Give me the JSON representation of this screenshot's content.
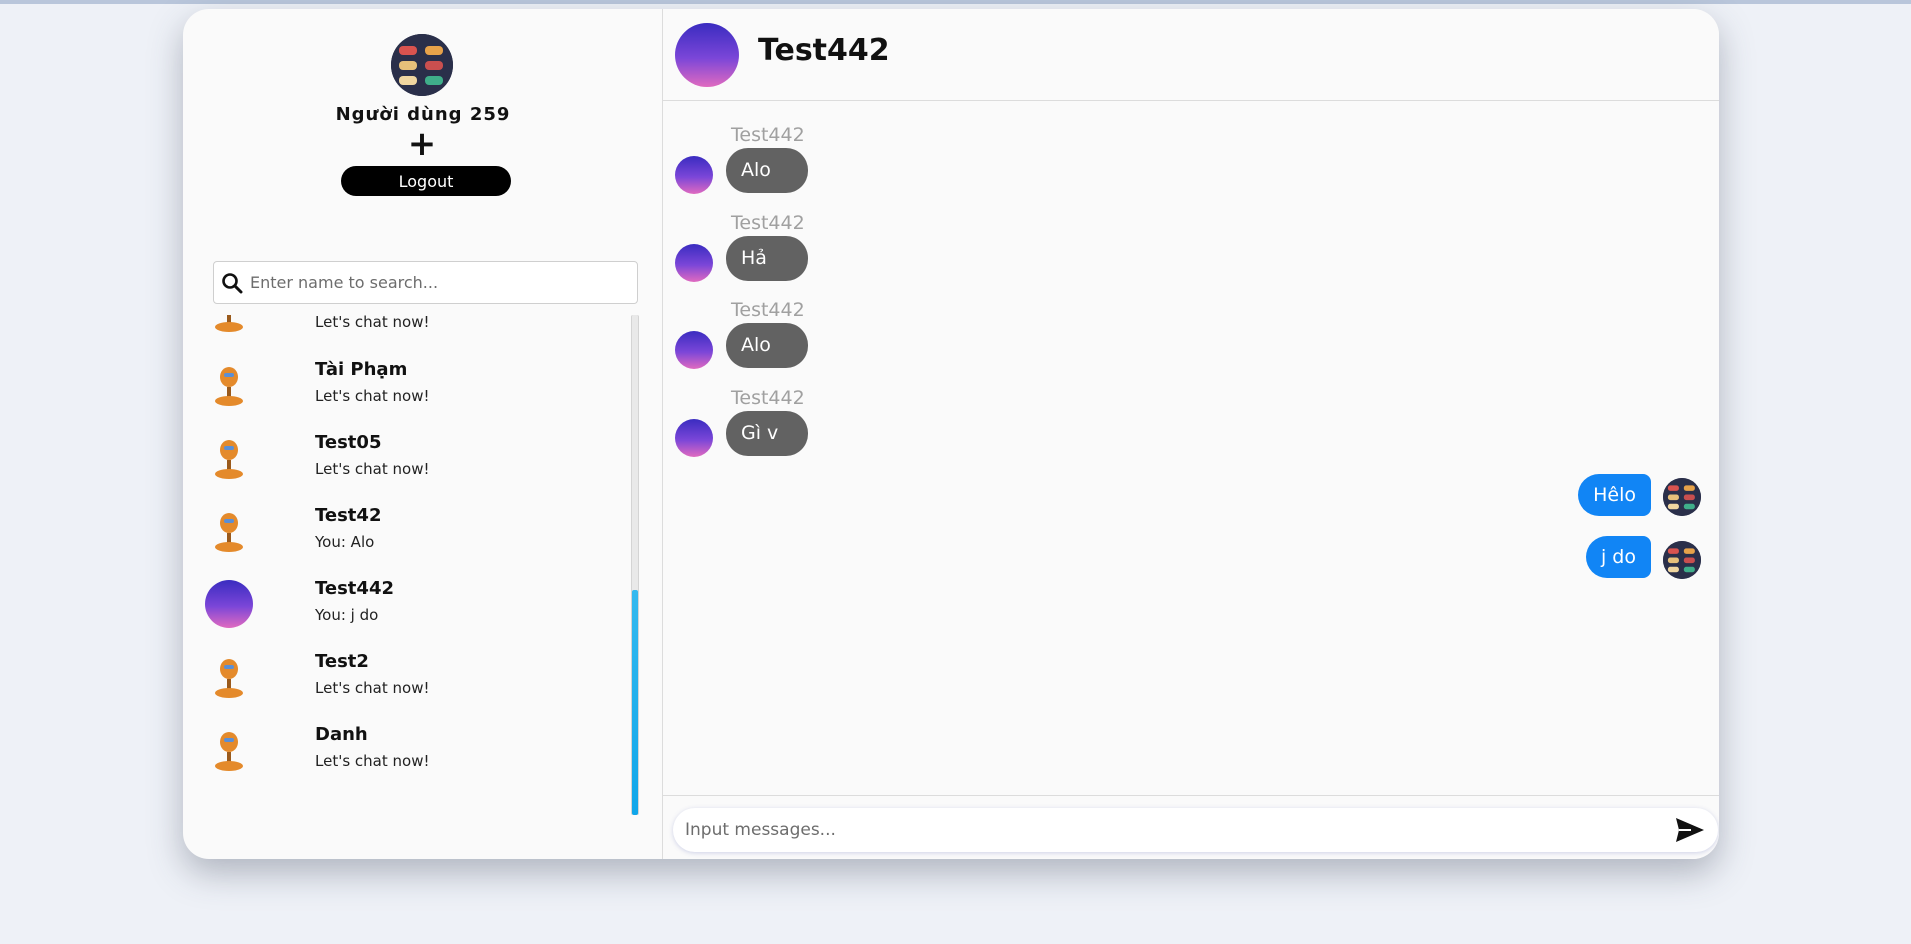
{
  "profile": {
    "username": "Người dùng 259",
    "add_label": "+",
    "logout_label": "Logout"
  },
  "search": {
    "placeholder": "Enter name to search..."
  },
  "contacts": [
    {
      "name": "",
      "last_message": "Let's chat now!",
      "avatar": "pumpkin-figure"
    },
    {
      "name": "Tài Phạm",
      "last_message": "Let's chat now!",
      "avatar": "pumpkin-figure"
    },
    {
      "name": "Test05",
      "last_message": "Let's chat now!",
      "avatar": "pumpkin-figure"
    },
    {
      "name": "Test42",
      "last_message": "You: Alo",
      "avatar": "pumpkin-figure"
    },
    {
      "name": "Test442",
      "last_message": "You: j do",
      "avatar": "purple-sky"
    },
    {
      "name": "Test2",
      "last_message": "Let's chat now!",
      "avatar": "pumpkin-figure"
    },
    {
      "name": "Danh",
      "last_message": "Let's chat now!",
      "avatar": "pumpkin-figure"
    }
  ],
  "chat": {
    "title": "Test442",
    "incoming": [
      {
        "sender": "Test442",
        "text": "Alo"
      },
      {
        "sender": "Test442",
        "text": "Hả"
      },
      {
        "sender": "Test442",
        "text": "Alo"
      },
      {
        "sender": "Test442",
        "text": "Gì v"
      }
    ],
    "outgoing": [
      {
        "text": "Hêlo"
      },
      {
        "text": "j do"
      }
    ],
    "composer_placeholder": "Input messages..."
  },
  "colors": {
    "accent": "#1185f5",
    "incoming_bubble": "#626262",
    "logout": "#000000",
    "scroll_thumb": "#10a6ea"
  },
  "icons": {
    "search": "search-icon",
    "send": "send-icon"
  }
}
